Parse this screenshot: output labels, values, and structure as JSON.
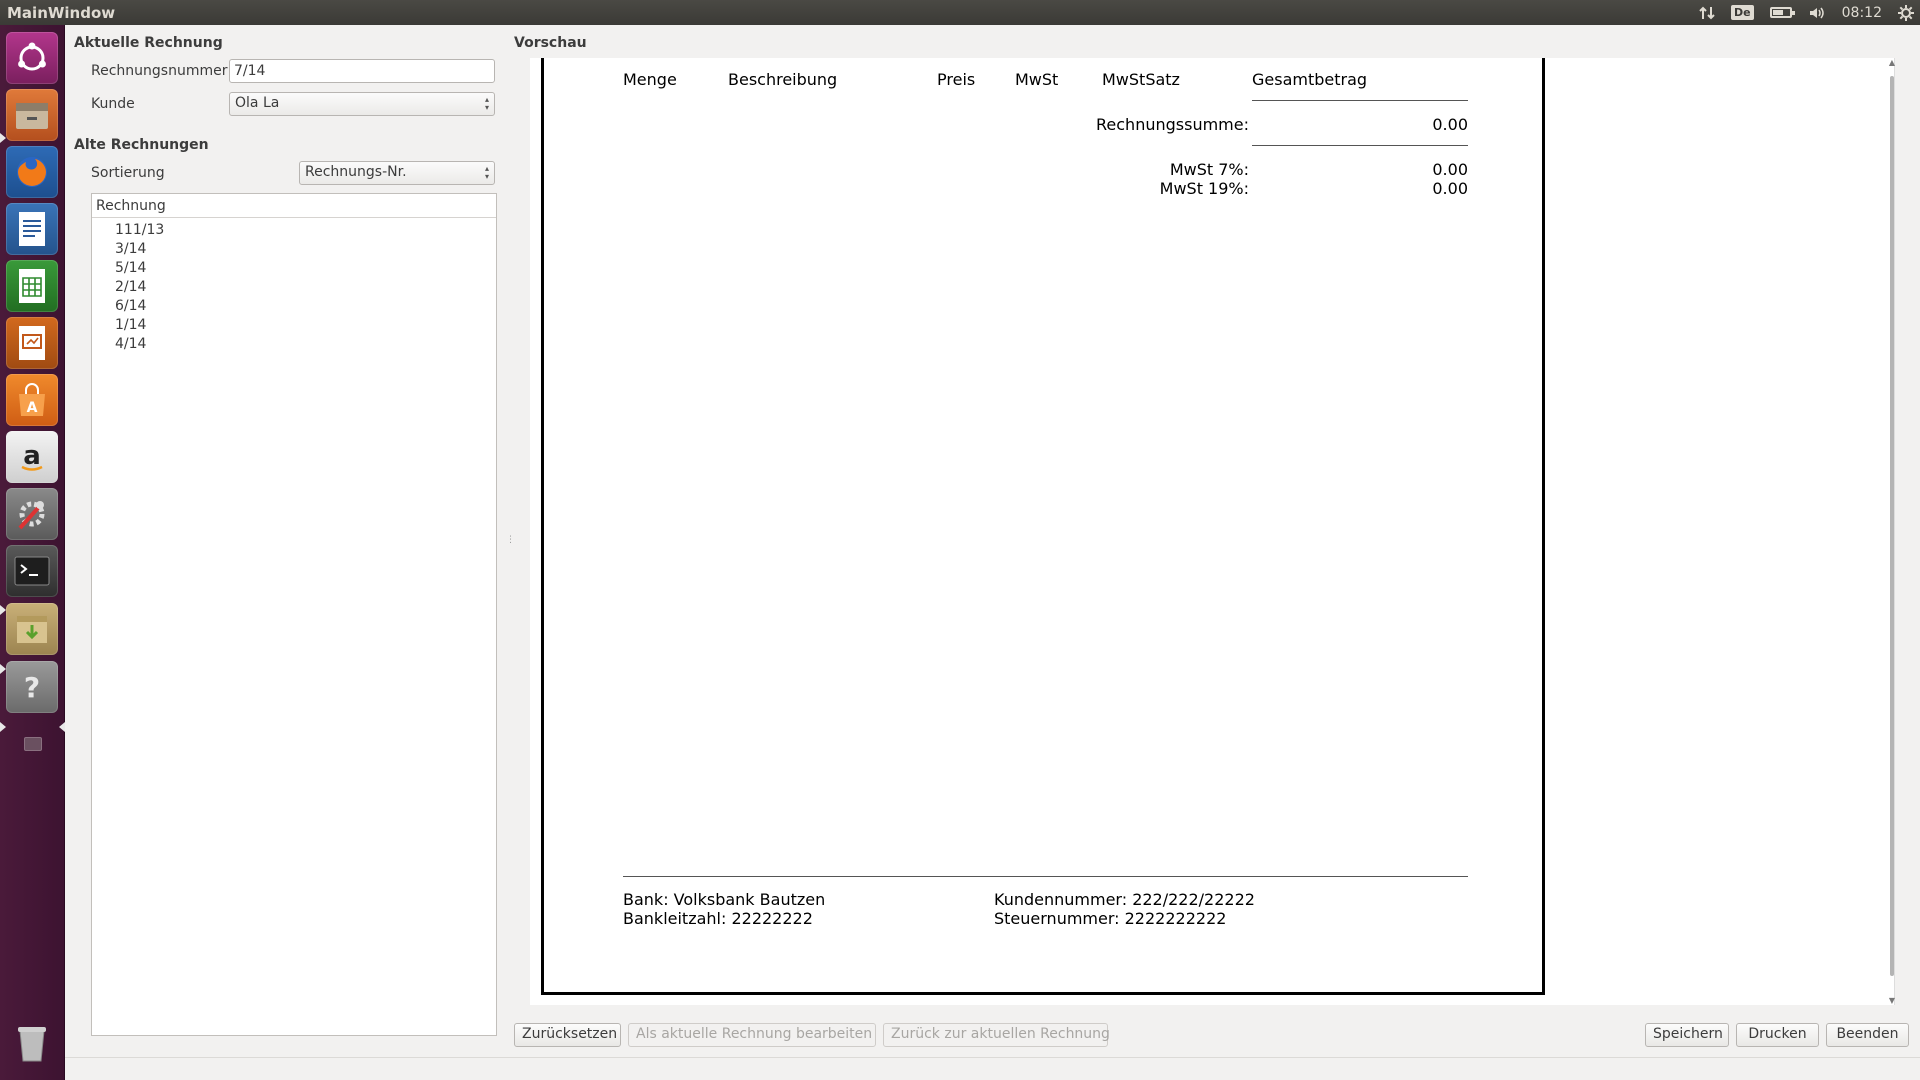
{
  "window": {
    "title": "MainWindow"
  },
  "indicators": {
    "keyboard": "De",
    "time": "08:12"
  },
  "launcher": {
    "items": [
      "ubuntu-dash-icon",
      "files-icon",
      "firefox-icon",
      "writer-icon",
      "calc-icon",
      "impress-icon",
      "software-center-icon",
      "amazon-icon",
      "system-settings-icon",
      "terminal-icon",
      "archive-manager-icon",
      "help-icon",
      "trash-icon"
    ]
  },
  "current": {
    "section_title": "Aktuelle Rechnung",
    "number_label": "Rechnungsnummer",
    "number_value": "7/14",
    "customer_label": "Kunde",
    "customer_value": "Ola La"
  },
  "old": {
    "section_title": "Alte Rechnungen",
    "sort_label": "Sortierung",
    "sort_value": "Rechnungs-Nr.",
    "list_header": "Rechnung",
    "items": [
      "111/13",
      "3/14",
      "5/14",
      "2/14",
      "6/14",
      "1/14",
      "4/14"
    ]
  },
  "preview": {
    "title": "Vorschau",
    "columns": {
      "qty": "Menge",
      "desc": "Beschreibung",
      "price": "Preis",
      "vat": "MwSt",
      "vat_rate": "MwStSatz",
      "total": "Gesamtbetrag"
    },
    "sum_label": "Rechnungssumme:",
    "sum_value": "0.00",
    "vat7_label": "MwSt 7%:",
    "vat7_value": "0.00",
    "vat19_label": "MwSt 19%:",
    "vat19_value": "0.00",
    "footer": {
      "bank": "Bank: Volksbank Bautzen",
      "blz": "Bankleitzahl: 22222222",
      "customer_no": "Kundennummer: 222/222/22222",
      "tax_no": "Steuernummer: 2222222222"
    }
  },
  "buttons": {
    "reset": "Zurücksetzen",
    "edit_as_current": "Als aktuelle Rechnung bearbeiten",
    "back_to_current": "Zurück zur aktuellen Rechnung",
    "save": "Speichern",
    "print": "Drucken",
    "quit": "Beenden"
  },
  "colors": {
    "launcher_bg": "#3d1331",
    "panel_bg": "#3b3a36",
    "window_bg": "#f2f1f0"
  }
}
